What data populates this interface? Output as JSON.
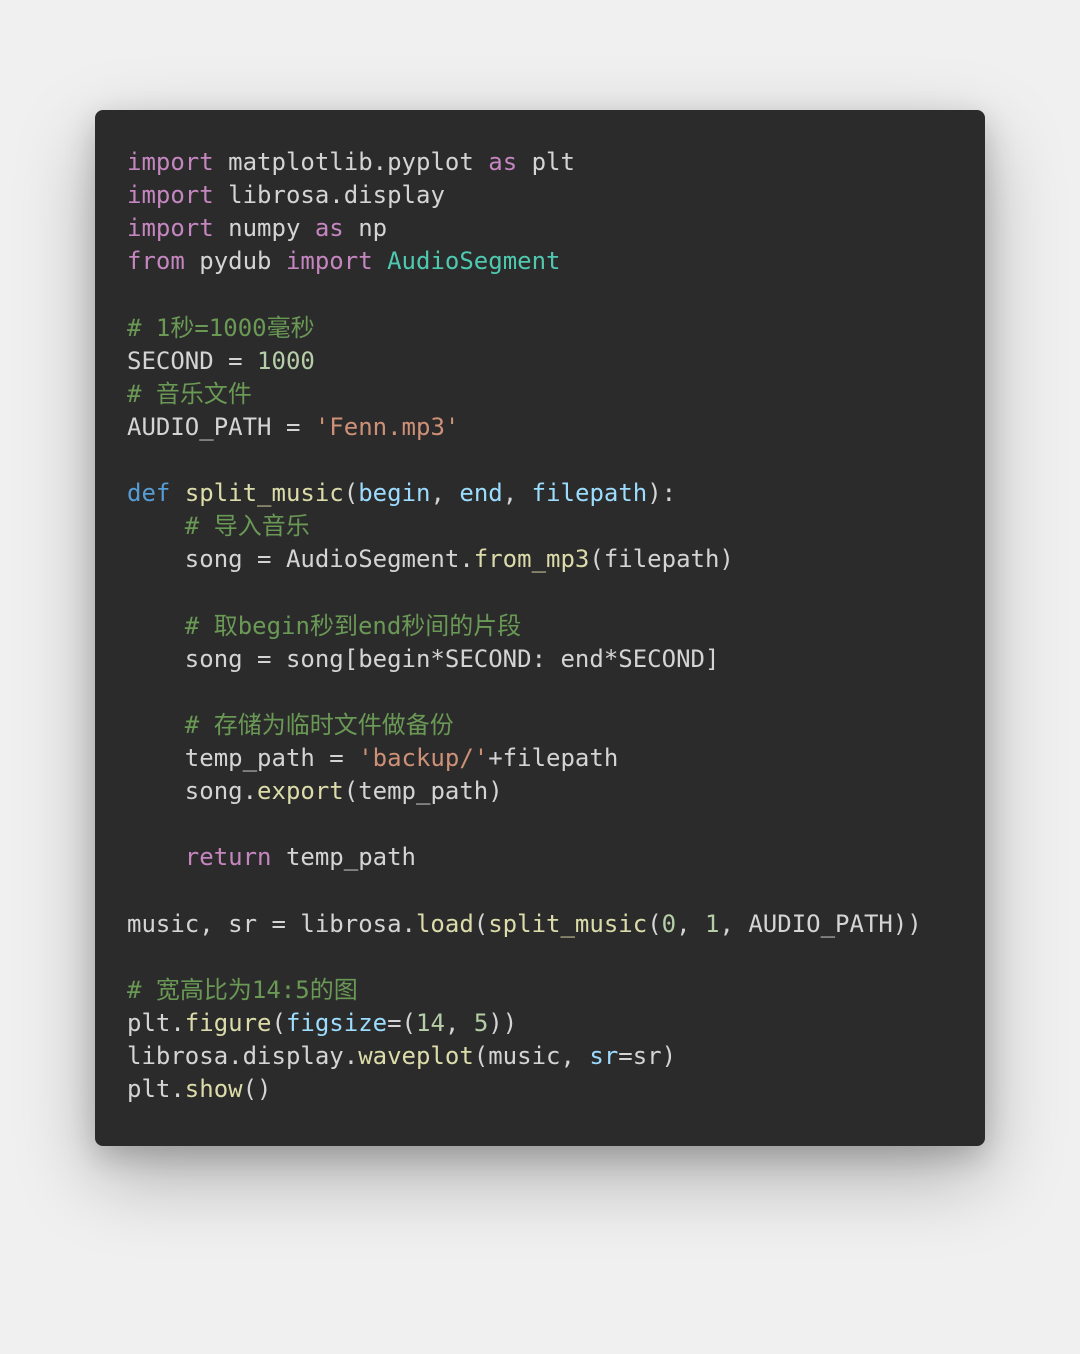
{
  "code": {
    "language": "python",
    "lines": [
      [
        {
          "t": "import",
          "c": "kw"
        },
        {
          "t": " matplotlib.pyplot ",
          "c": "mod"
        },
        {
          "t": "as",
          "c": "kw"
        },
        {
          "t": " plt",
          "c": "mod"
        }
      ],
      [
        {
          "t": "import",
          "c": "kw"
        },
        {
          "t": " librosa.display",
          "c": "mod"
        }
      ],
      [
        {
          "t": "import",
          "c": "kw"
        },
        {
          "t": " numpy ",
          "c": "mod"
        },
        {
          "t": "as",
          "c": "kw"
        },
        {
          "t": " np",
          "c": "mod"
        }
      ],
      [
        {
          "t": "from",
          "c": "kw"
        },
        {
          "t": " pydub ",
          "c": "mod"
        },
        {
          "t": "import",
          "c": "kw"
        },
        {
          "t": " AudioSegment",
          "c": "cls"
        }
      ],
      [],
      [
        {
          "t": "# 1秒=1000毫秒",
          "c": "cmt"
        }
      ],
      [
        {
          "t": "SECOND = ",
          "c": "mod"
        },
        {
          "t": "1000",
          "c": "num"
        }
      ],
      [
        {
          "t": "# 音乐文件",
          "c": "cmt"
        }
      ],
      [
        {
          "t": "AUDIO_PATH = ",
          "c": "mod"
        },
        {
          "t": "'Fenn.mp3'",
          "c": "str"
        }
      ],
      [],
      [
        {
          "t": "def",
          "c": "blue"
        },
        {
          "t": " ",
          "c": "mod"
        },
        {
          "t": "split_music",
          "c": "fn"
        },
        {
          "t": "(",
          "c": "mod"
        },
        {
          "t": "begin",
          "c": "prm"
        },
        {
          "t": ", ",
          "c": "mod"
        },
        {
          "t": "end",
          "c": "prm"
        },
        {
          "t": ", ",
          "c": "mod"
        },
        {
          "t": "filepath",
          "c": "prm"
        },
        {
          "t": "):",
          "c": "mod"
        }
      ],
      [
        {
          "t": "    ",
          "c": "mod"
        },
        {
          "t": "# 导入音乐",
          "c": "cmt"
        }
      ],
      [
        {
          "t": "    song = AudioSegment.",
          "c": "mod"
        },
        {
          "t": "from_mp3",
          "c": "fn"
        },
        {
          "t": "(filepath)",
          "c": "mod"
        }
      ],
      [
        {
          "t": "    ",
          "c": "mod"
        }
      ],
      [
        {
          "t": "    ",
          "c": "mod"
        },
        {
          "t": "# 取begin秒到end秒间的片段",
          "c": "cmt"
        }
      ],
      [
        {
          "t": "    song = song[begin*SECOND: end*SECOND]",
          "c": "mod"
        }
      ],
      [
        {
          "t": "    ",
          "c": "mod"
        }
      ],
      [
        {
          "t": "    ",
          "c": "mod"
        },
        {
          "t": "# 存储为临时文件做备份",
          "c": "cmt"
        }
      ],
      [
        {
          "t": "    temp_path = ",
          "c": "mod"
        },
        {
          "t": "'backup/'",
          "c": "str"
        },
        {
          "t": "+filepath",
          "c": "mod"
        }
      ],
      [
        {
          "t": "    song.",
          "c": "mod"
        },
        {
          "t": "export",
          "c": "fn"
        },
        {
          "t": "(temp_path)",
          "c": "mod"
        }
      ],
      [
        {
          "t": "    ",
          "c": "mod"
        }
      ],
      [
        {
          "t": "    ",
          "c": "mod"
        },
        {
          "t": "return",
          "c": "kw"
        },
        {
          "t": " temp_path",
          "c": "mod"
        }
      ],
      [],
      [
        {
          "t": "music, sr = librosa.",
          "c": "mod"
        },
        {
          "t": "load",
          "c": "fn"
        },
        {
          "t": "(",
          "c": "mod"
        },
        {
          "t": "split_music",
          "c": "fn"
        },
        {
          "t": "(",
          "c": "mod"
        },
        {
          "t": "0",
          "c": "num"
        },
        {
          "t": ", ",
          "c": "mod"
        },
        {
          "t": "1",
          "c": "num"
        },
        {
          "t": ", AUDIO_PATH))",
          "c": "mod"
        }
      ],
      [],
      [
        {
          "t": "# 宽高比为14:5的图",
          "c": "cmt"
        }
      ],
      [
        {
          "t": "plt.",
          "c": "mod"
        },
        {
          "t": "figure",
          "c": "fn"
        },
        {
          "t": "(",
          "c": "mod"
        },
        {
          "t": "figsize",
          "c": "prm"
        },
        {
          "t": "=(",
          "c": "mod"
        },
        {
          "t": "14",
          "c": "num"
        },
        {
          "t": ", ",
          "c": "mod"
        },
        {
          "t": "5",
          "c": "num"
        },
        {
          "t": "))",
          "c": "mod"
        }
      ],
      [
        {
          "t": "librosa.display.",
          "c": "mod"
        },
        {
          "t": "waveplot",
          "c": "fn"
        },
        {
          "t": "(music, ",
          "c": "mod"
        },
        {
          "t": "sr",
          "c": "prm"
        },
        {
          "t": "=sr)",
          "c": "mod"
        }
      ],
      [
        {
          "t": "plt.",
          "c": "mod"
        },
        {
          "t": "show",
          "c": "fn"
        },
        {
          "t": "()",
          "c": "mod"
        }
      ]
    ]
  }
}
